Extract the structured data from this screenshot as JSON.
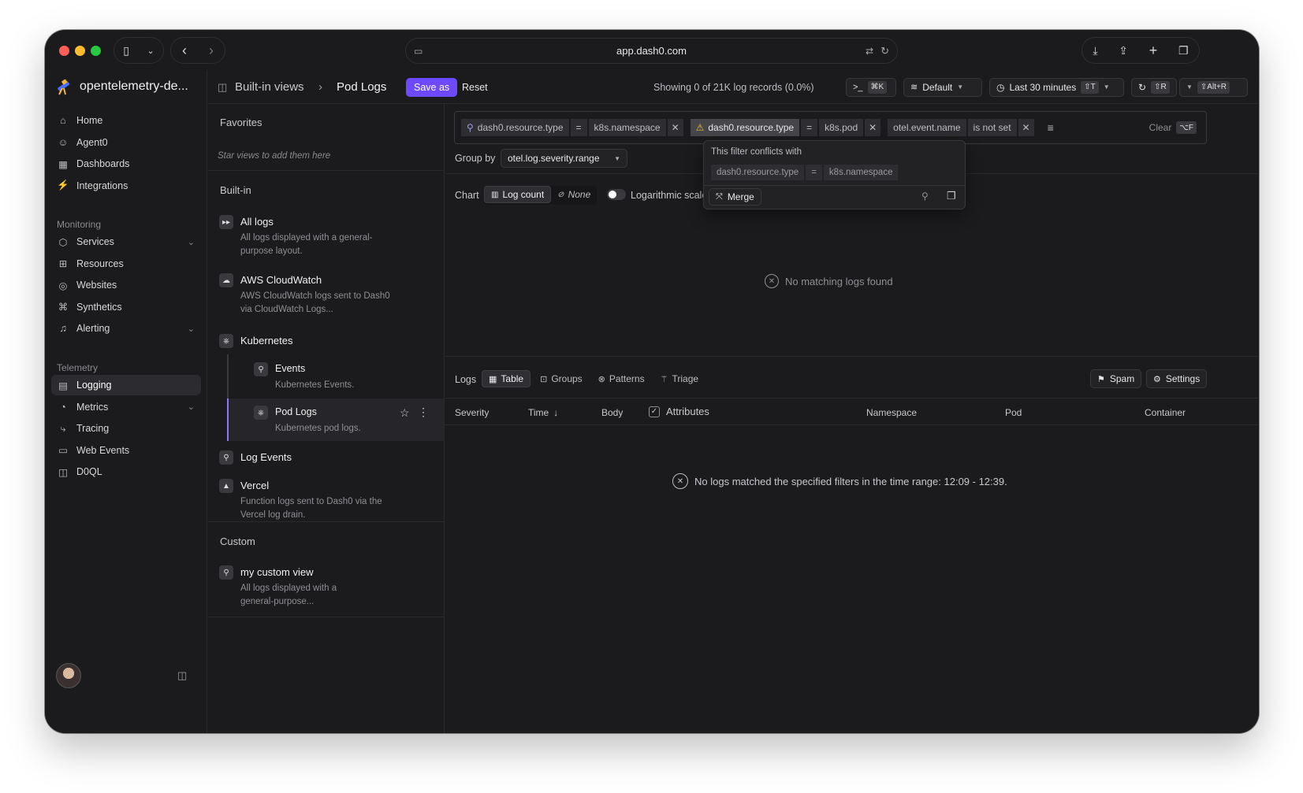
{
  "browser": {
    "url": "app.dash0.com"
  },
  "sidebar": {
    "org_name": "opentelemetry-de...",
    "items_top": [
      {
        "label": "Home",
        "icon": "home-icon"
      },
      {
        "label": "Agent0",
        "icon": "agent-icon"
      },
      {
        "label": "Dashboards",
        "icon": "dashboard-icon"
      },
      {
        "label": "Integrations",
        "icon": "plug-icon"
      }
    ],
    "monitoring_label": "Monitoring",
    "items_monitoring": [
      {
        "label": "Services",
        "icon": "cube-icon"
      },
      {
        "label": "Resources",
        "icon": "grid-icon"
      },
      {
        "label": "Websites",
        "icon": "globe-icon"
      },
      {
        "label": "Synthetics",
        "icon": "robot-icon"
      },
      {
        "label": "Alerting",
        "icon": "bell-icon"
      }
    ],
    "telemetry_label": "Telemetry",
    "items_telemetry": [
      {
        "label": "Logging",
        "icon": "log-icon"
      },
      {
        "label": "Metrics",
        "icon": "gauge-icon"
      },
      {
        "label": "Tracing",
        "icon": "trace-icon"
      },
      {
        "label": "Web Events",
        "icon": "browser-icon"
      },
      {
        "label": "D0QL",
        "icon": "database-icon"
      }
    ]
  },
  "header": {
    "breadcrumb_root": "Built-in views",
    "breadcrumb_sep": "›",
    "breadcrumb_current": "Pod Logs",
    "save_as": "Save as",
    "reset": "Reset",
    "showing": "Showing 0 of 21K log records (0.0%)",
    "cmd_kbd": "⌘K",
    "default_label": "Default",
    "time_label": "Last 30 minutes",
    "time_kbd": "⇧T",
    "refresh_kbd": "⇧R",
    "alt_kbd": "⇧Alt+R"
  },
  "views": {
    "favorites_label": "Favorites",
    "favorites_hint": "Star views to add them here",
    "builtin_label": "Built-in",
    "builtin": [
      {
        "title": "All logs",
        "desc": "All logs displayed with a general-purpose layout."
      },
      {
        "title": "AWS CloudWatch",
        "desc": "AWS CloudWatch logs sent to Dash0 via CloudWatch Logs..."
      },
      {
        "title": "Kubernetes",
        "desc": ""
      }
    ],
    "k8s_children": [
      {
        "title": "Events",
        "desc": "Kubernetes Events."
      },
      {
        "title": "Pod Logs",
        "desc": "Kubernetes pod logs."
      }
    ],
    "builtin_more": [
      {
        "title": "Log Events",
        "desc": ""
      },
      {
        "title": "Vercel",
        "desc": "Function logs sent to Dash0 via the Vercel log drain."
      }
    ],
    "custom_label": "Custom",
    "custom": [
      {
        "title": "my custom view",
        "desc": "All logs displayed with a general-purpose..."
      }
    ]
  },
  "filters": [
    {
      "key": "dash0.resource.type",
      "op": "=",
      "value": "k8s.namespace",
      "icon": "pin-icon"
    },
    {
      "key": "dash0.resource.type",
      "op": "=",
      "value": "k8s.pod",
      "icon": "warning-icon"
    },
    {
      "key": "otel.event.name",
      "op": "is not set",
      "value": "",
      "icon": ""
    }
  ],
  "filter_clear": "Clear",
  "filter_clear_kbd": "⌥F",
  "groupby": {
    "label": "Group by",
    "value": "otel.log.severity.range"
  },
  "popover": {
    "title": "This filter conflicts with",
    "key": "dash0.resource.type",
    "op": "=",
    "value": "k8s.namespace",
    "merge": "Merge"
  },
  "chart": {
    "label": "Chart",
    "log_count": "Log count",
    "none": "None",
    "log_scale": "Logarithmic scale",
    "empty": "No matching logs found"
  },
  "logs": {
    "label": "Logs",
    "tabs": [
      "Table",
      "Groups",
      "Patterns",
      "Triage"
    ],
    "spam": "Spam",
    "settings": "Settings",
    "columns": [
      "Severity",
      "Time",
      "Body",
      "Attributes",
      "Namespace",
      "Pod",
      "Container"
    ],
    "empty": "No logs matched the specified filters in the time range: 12:09 - 12:39."
  },
  "colors": {
    "accent": "#6d4aff",
    "bg": "#1b1b1d"
  }
}
